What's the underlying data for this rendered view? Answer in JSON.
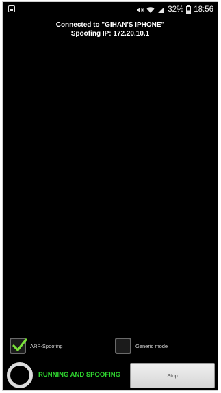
{
  "status_bar": {
    "app_icon": "image-notification-icon",
    "icons": [
      "mute-icon",
      "wifi-icon",
      "signal-icon"
    ],
    "battery": "32%",
    "battery_icon": "battery-icon",
    "time": "18:56"
  },
  "connection": {
    "connected_to": "Connected to \"GIHAN'S IPHONE\"",
    "spoofing_ip": "Spoofing IP: 172.20.10.1"
  },
  "options": {
    "arp_spoofing": {
      "label": "ARP-Spoofing",
      "checked": true
    },
    "generic_mode": {
      "label": "Generic mode",
      "checked": false
    }
  },
  "status": {
    "text": "RUNNING AND SPOOFING",
    "color": "#2fd52f"
  },
  "stop_button": {
    "label": "Stop"
  }
}
